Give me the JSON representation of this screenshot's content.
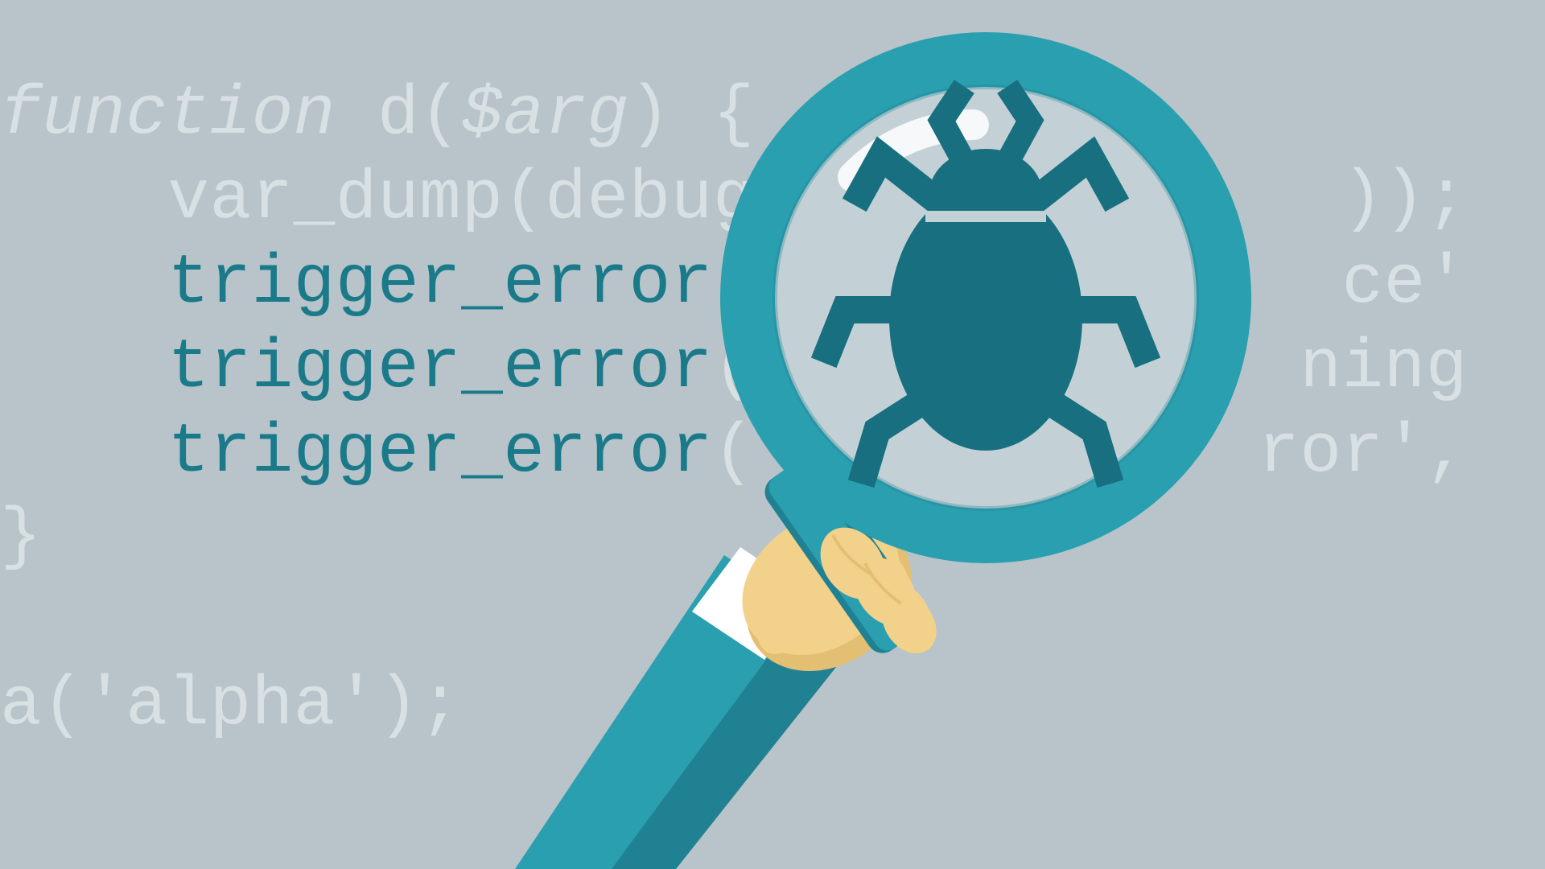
{
  "code": {
    "line1_a": "function",
    "line1_b": " d(",
    "line1_c": "$arg",
    "line1_d": ") {",
    "line2": "    var_dump(debug_             ));",
    "line3_a": "    ",
    "line3_b": "trigger_error",
    "line3_c": "(              ce'",
    "line4_a": "    ",
    "line4_b": "trigger_error",
    "line4_c": "(             ning",
    "line5_a": "    ",
    "line5_b": "trigger_error",
    "line5_c": "('           ror',",
    "line6": "}",
    "line7": "",
    "line8": "a('alpha');"
  },
  "colors": {
    "bg": "#b8c4c9",
    "light_text": "#d8e0e3",
    "teal_text": "#1a7a8a",
    "magnifier_ring": "#2a9fb0",
    "magnifier_ring_dark": "#1f8191",
    "bug": "#176f7f",
    "lens": "#c3d1d6",
    "hand": "#f2d28b",
    "hand_shadow": "#e3bf73",
    "sleeve": "#2a9fb0",
    "sleeve_dark": "#1f8191",
    "cuff": "#ffffff"
  },
  "illustration": {
    "name": "hand holding magnifying glass over code bug"
  }
}
